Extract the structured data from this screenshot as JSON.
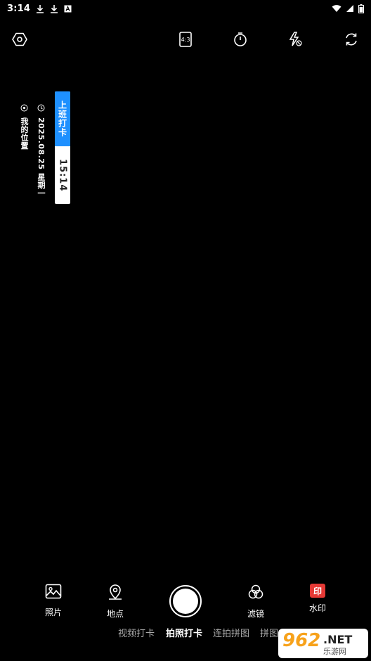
{
  "status_bar": {
    "time": "3:14",
    "left_icons": [
      "download-icon",
      "download-icon",
      "text-a-icon"
    ],
    "right_icons": [
      "wifi-icon",
      "signal-icon",
      "battery-icon"
    ]
  },
  "top_bar": {
    "icons": [
      "settings-hex-icon",
      "aspect-ratio-icon",
      "timer-icon",
      "flash-auto-off-icon",
      "switch-camera-icon"
    ],
    "aspect_label": "4:3"
  },
  "watermark": {
    "title": "上班打卡",
    "time": "15:14",
    "date": "2025.08.25 星期一",
    "location": "我的位置",
    "accent": "#1e90ff"
  },
  "bottom_bar": {
    "photos_label": "照片",
    "location_label": "地点",
    "filter_label": "滤镜",
    "watermark_label": "水印",
    "watermark_badge": "印",
    "badge_color": "#e53935"
  },
  "modes": {
    "items": [
      "视频打卡",
      "拍照打卡",
      "连拍拼图",
      "拼图"
    ],
    "active": "拍照打卡"
  },
  "overlay_logo": {
    "number": "962",
    "suffix": ".NET",
    "site": "乐游网"
  }
}
